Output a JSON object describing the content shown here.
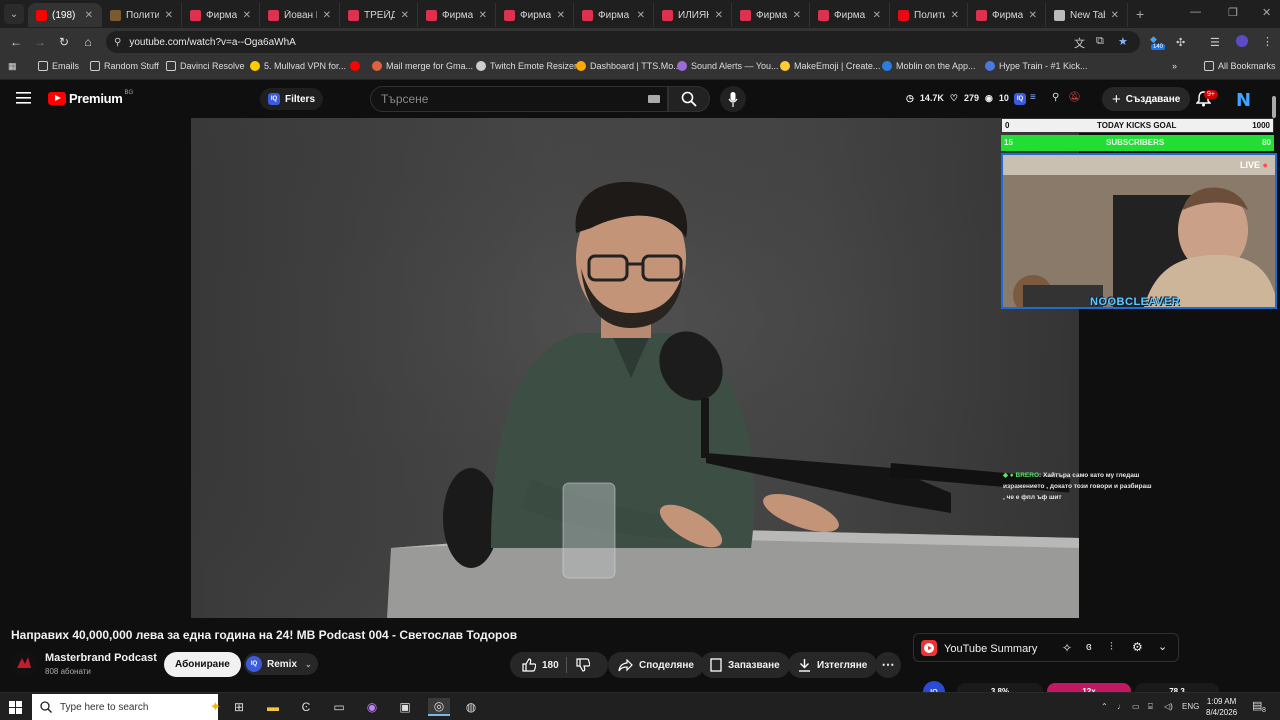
{
  "browser": {
    "tabs": [
      {
        "title": "(198)",
        "fav": "#ff0000",
        "w": 74,
        "active": true
      },
      {
        "title": "Полити",
        "fav": "#7a5a30",
        "w": 80
      },
      {
        "title": "Фирма",
        "fav": "#e03050",
        "w": 78
      },
      {
        "title": "Йован Й",
        "fav": "#e03050",
        "w": 80
      },
      {
        "title": "ТРЕЙДО",
        "fav": "#e03050",
        "w": 78
      },
      {
        "title": "Фирма",
        "fav": "#e03050",
        "w": 78
      },
      {
        "title": "Фирма",
        "fav": "#e03050",
        "w": 78
      },
      {
        "title": "Фирма",
        "fav": "#e03050",
        "w": 80
      },
      {
        "title": "ИЛИЯН",
        "fav": "#e03050",
        "w": 78
      },
      {
        "title": "Фирма",
        "fav": "#e03050",
        "w": 78
      },
      {
        "title": "Фирма",
        "fav": "#e03050",
        "w": 80
      },
      {
        "title": "Полити",
        "fav": "#e50914",
        "w": 78
      },
      {
        "title": "Фирма",
        "fav": "#e03050",
        "w": 78
      },
      {
        "title": "New Tab",
        "fav": "#bbbbbb",
        "w": 82
      }
    ],
    "url": "youtube.com/watch?v=a--Oga6aWhA",
    "ext_badge": "140",
    "bookmarks": [
      {
        "label": "Emails",
        "color": "folder"
      },
      {
        "label": "Random Stuff",
        "color": "folder"
      },
      {
        "label": "Davinci Resolve",
        "color": "folder"
      },
      {
        "label": "5. Mullvad VPN for...",
        "color": "#ffcc00"
      },
      {
        "label": "",
        "color": "#ff0000"
      },
      {
        "label": "Mail merge for Gma...",
        "color": "#e06040"
      },
      {
        "label": "Twitch Emote Resizer",
        "color": "#cccccc"
      },
      {
        "label": "Dashboard | TTS.Mo...",
        "color": "#ffaa00"
      },
      {
        "label": "Sound Alerts — You...",
        "color": "#9a6bd6"
      },
      {
        "label": "MakeEmoji | Create...",
        "color": "#ffcc33"
      },
      {
        "label": "Moblin on the App...",
        "color": "#2a7de1"
      },
      {
        "label": "Hype Train - #1 Kick...",
        "color": "#4a78e0"
      }
    ],
    "all_bookmarks": "All Bookmarks"
  },
  "youtube": {
    "logo": "Premium",
    "country": "BG",
    "filters": "Filters",
    "search_placeholder": "Търсене",
    "stats": {
      "views": "14.7K",
      "likes": "279",
      "watching": "10"
    },
    "create": "Създаване",
    "notif_badge": "9+",
    "avatar_letter": "N"
  },
  "overlay": {
    "goal_left": "0",
    "goal_label": "TODAY KICKS GOAL",
    "goal_right": "1000",
    "subs_left": "15",
    "subs_label": "SUBSCRIBERS",
    "subs_right": "80",
    "live": "LIVE",
    "streamer": "NOOBCLEAVER",
    "chat_user": "BRERO",
    "chat_msg": ": Хайтъра само като му гледаш изражението , докато този говори и разбираш , че е фпл ъф шит"
  },
  "video": {
    "title": "Направих 40,000,000 лева за една година на 24! MB Podcast 004 - Светослав Тодоров",
    "channel": "Masterbrand Podcast",
    "subs": "808 абонати",
    "subscribe": "Абониране",
    "remix": "Remix",
    "likes": "180",
    "share": "Споделяне",
    "save": "Запазване",
    "download": "Изтегляне"
  },
  "summary": {
    "title": "YouTube Summary",
    "metrics": [
      "3.8%",
      "12x",
      "78.3"
    ]
  },
  "taskbar": {
    "search": "Type here to search",
    "lang": "ENG",
    "time": "1:09 AM",
    "date": "8/4/2026",
    "notif": "8"
  }
}
